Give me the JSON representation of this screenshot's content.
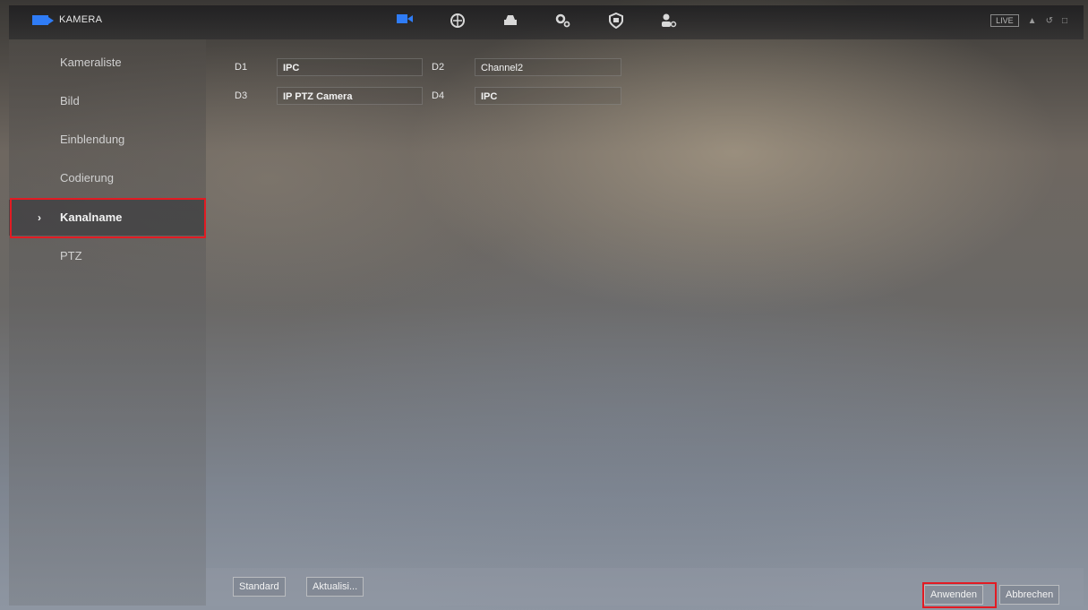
{
  "header": {
    "title": "KAMERA",
    "live_label": "LIVE",
    "nav_icons": [
      "camera-icon",
      "network-icon",
      "storage-icon",
      "system-icon",
      "security-icon",
      "account-icon"
    ]
  },
  "sidebar": {
    "items": [
      {
        "label": "Kameraliste"
      },
      {
        "label": "Bild"
      },
      {
        "label": "Einblendung"
      },
      {
        "label": "Codierung"
      },
      {
        "label": "Kanalname"
      },
      {
        "label": "PTZ"
      }
    ],
    "active_index": 4
  },
  "channels": [
    {
      "id": "D1",
      "name": "IPC"
    },
    {
      "id": "D2",
      "name": "Channel2"
    },
    {
      "id": "D3",
      "name": "IP PTZ Camera"
    },
    {
      "id": "D4",
      "name": "IPC"
    }
  ],
  "footer": {
    "default_label": "Standard",
    "refresh_label": "Aktualisi...",
    "apply_label": "Anwenden",
    "cancel_label": "Abbrechen"
  },
  "colors": {
    "accent": "#2f7cf6",
    "highlight": "#e21b23"
  }
}
